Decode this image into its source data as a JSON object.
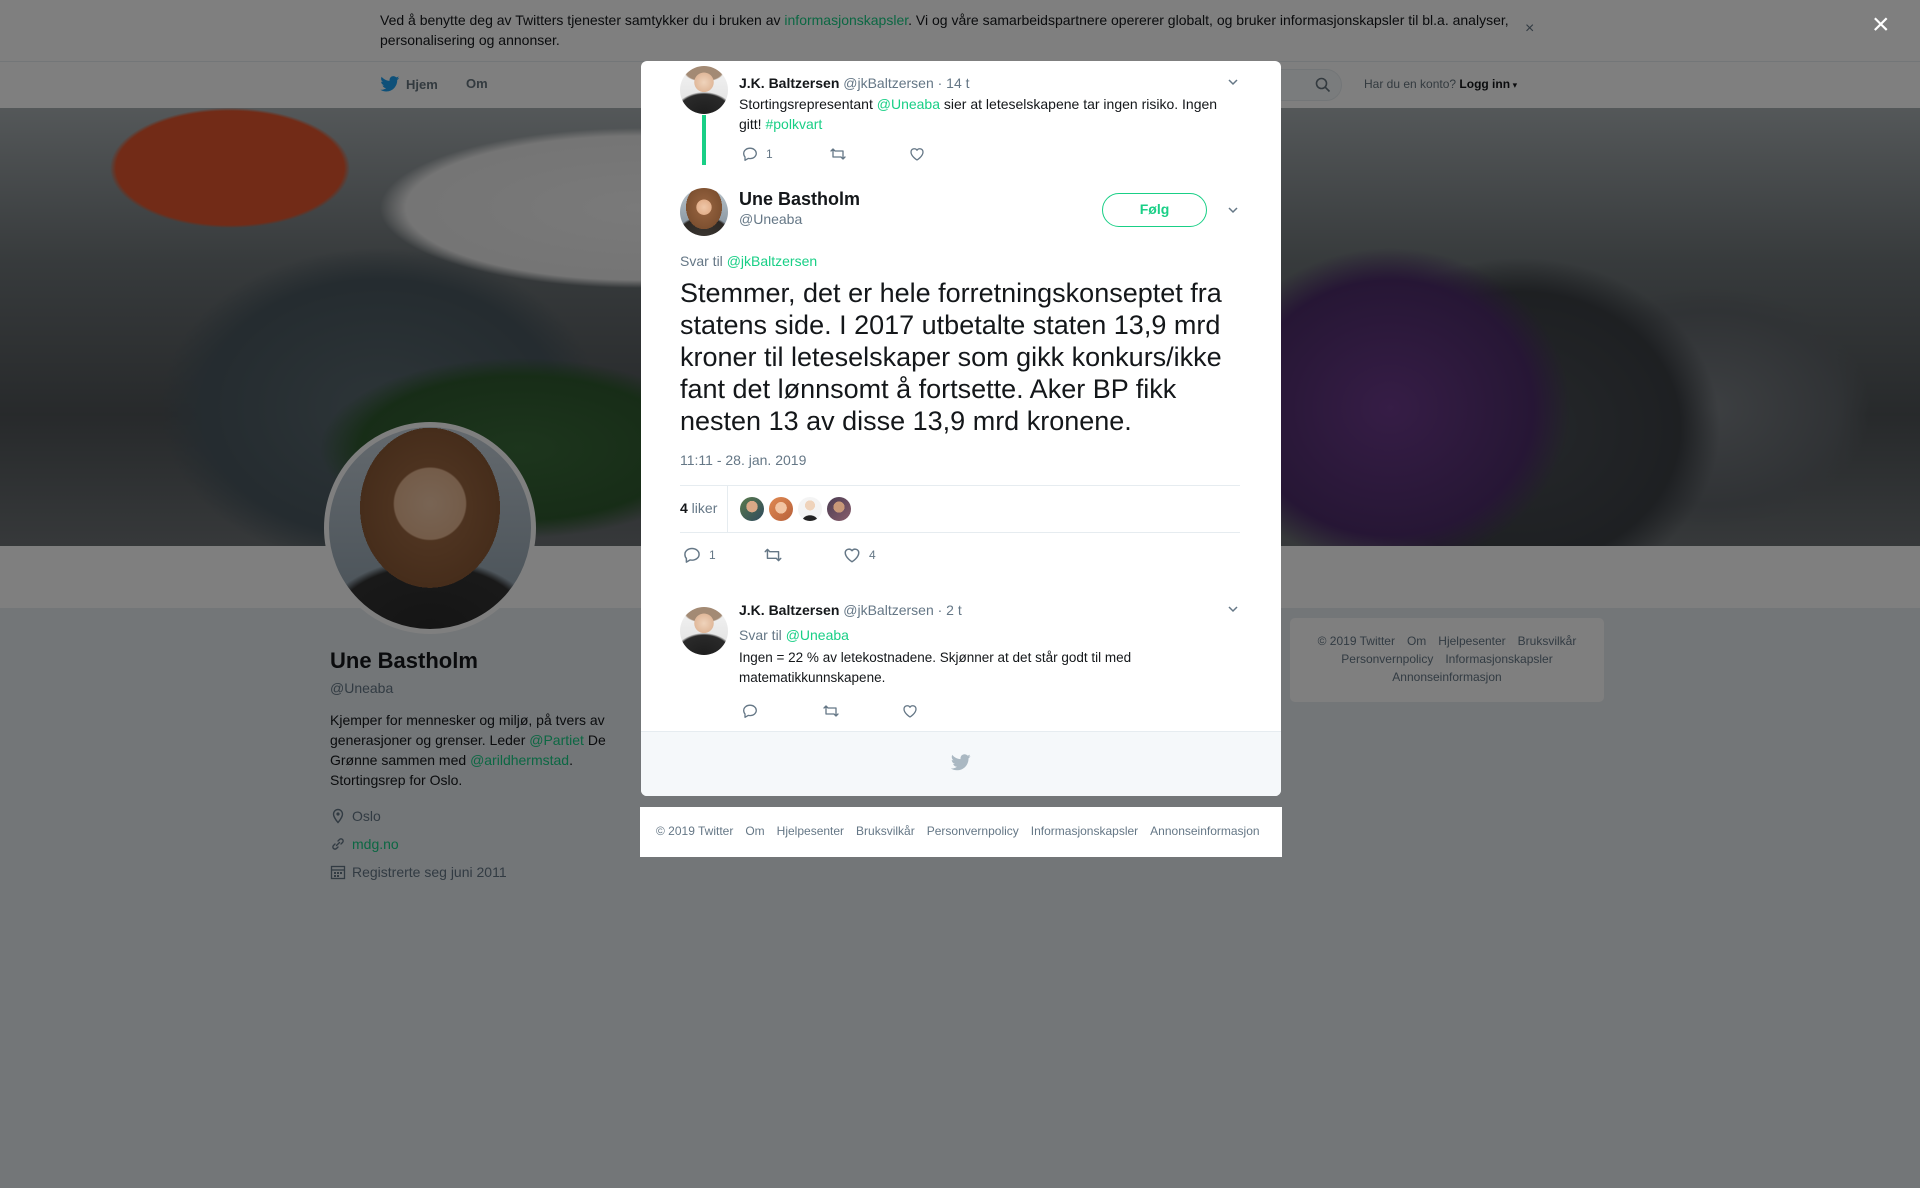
{
  "cookie_banner": {
    "text_before": "Ved å benytte deg av Twitters tjenester samtykker du i bruken av ",
    "link": "informasjonskapsler",
    "text_after": ". Vi og våre samarbeidspartnere opererer globalt, og bruker informasjonskapsler til bl.a. analyser, personalisering og annonser.",
    "close": "×"
  },
  "topnav": {
    "home": "Hjem",
    "about": "Om",
    "login_prompt": "Har du en konto?",
    "login": "Logg inn"
  },
  "profile": {
    "name": "Une Bastholm",
    "handle": "@Uneaba",
    "bio_1": "Kjemper for mennesker og miljø, på tvers av generasjoner og grenser. Leder ",
    "bio_link_1": "@Partiet",
    "bio_2": " De Grønne sammen med ",
    "bio_link_2": "@arildhermstad",
    "bio_3": ". Stortingsrep for Oslo.",
    "location": "Oslo",
    "website": "mdg.no",
    "joined": "Registrerte seg juni 2011"
  },
  "side_footer": {
    "items": [
      "© 2019 Twitter",
      "Om",
      "Hjelpesenter",
      "Bruksvilkår",
      "Personvernpolicy",
      "Informasjonskapsler",
      "Annonseinformasjon"
    ]
  },
  "overlay": {
    "close": "×"
  },
  "tweet_parent": {
    "name": "J.K. Baltzersen",
    "handle": "@jkBaltzersen",
    "time": "· 14 t",
    "text_1": "Stortingsrepresentant ",
    "mention": "@Uneaba",
    "text_2": " sier at leteselskapene tar ingen risiko. Ingen gitt! ",
    "hashtag": "#polkvart",
    "reply_count": "1"
  },
  "tweet_main": {
    "name": "Une Bastholm",
    "handle": "@Uneaba",
    "follow": "Følg",
    "reply_prefix": "Svar til ",
    "reply_handle": "@jkBaltzersen",
    "text": "Stemmer, det er hele forretningskonseptet fra statens side. I 2017 utbetalte staten 13,9 mrd kroner til leteselskaper som gikk konkurs/ikke fant det lønnsomt å fortsette. Aker BP fikk nesten 13 av disse 13,9 mrd kronene.",
    "timestamp": "11:11 - 28. jan. 2019",
    "likes_count": "4",
    "likes_label": " liker",
    "reply_count": "1",
    "like_count": "4"
  },
  "tweet_reply": {
    "name": "J.K. Baltzersen",
    "handle": "@jkBaltzersen",
    "time": "· 2 t",
    "reply_prefix": "Svar til ",
    "reply_handle": "@Uneaba",
    "text": "Ingen = 22 % av letekostnadene. Skjønner at det står godt til med matematikkunnskapene."
  },
  "bottom_footer": {
    "items": [
      "© 2019 Twitter",
      "Om",
      "Hjelpesenter",
      "Bruksvilkår",
      "Personvernpolicy",
      "Informasjonskapsler",
      "Annonseinformasjon"
    ]
  },
  "colors": {
    "accent": "#19cf86",
    "text": "#14171a",
    "muted": "#657786",
    "twitter_blue": "#1da1f2"
  },
  "icons": [
    "twitter-bird-icon",
    "search-icon",
    "reply-icon",
    "retweet-icon",
    "heart-icon",
    "chevron-down-icon",
    "location-icon",
    "link-icon",
    "calendar-icon",
    "close-icon"
  ]
}
